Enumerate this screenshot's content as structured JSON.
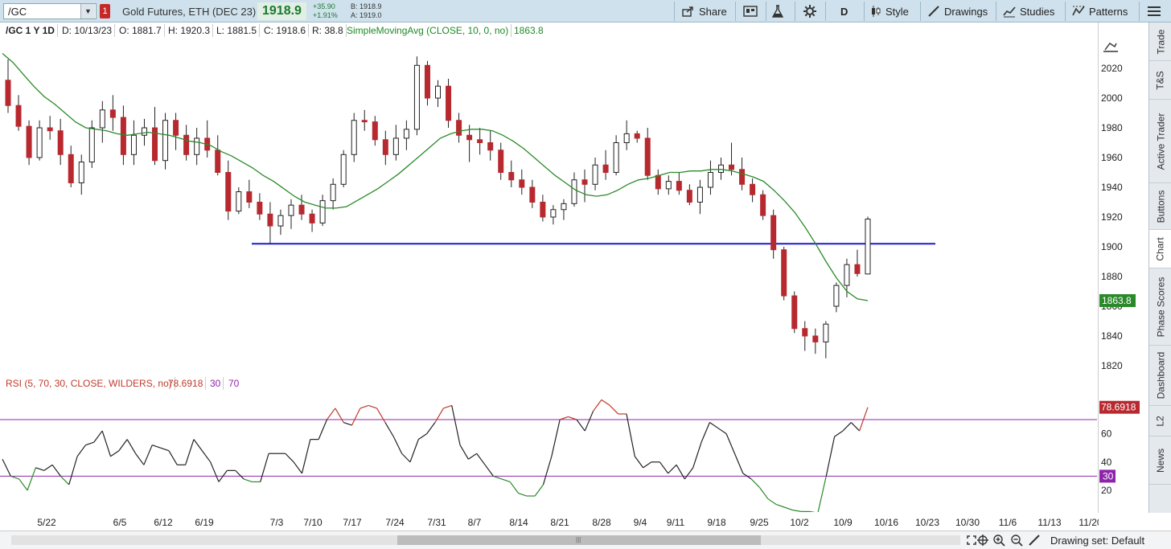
{
  "toolbar": {
    "symbol": "/GC",
    "alert_count": "1",
    "description": "Gold Futures, ETH (DEC 23)",
    "last_price": "1918.9",
    "net_change": "+35.90",
    "pct_change": "+1.91%",
    "bid": "B: 1918.9",
    "ask": "A: 1919.0",
    "share_label": "Share",
    "aggregation": "D",
    "style_label": "Style",
    "drawings_label": "Drawings",
    "studies_label": "Studies",
    "patterns_label": "Patterns"
  },
  "info_bar": {
    "symbol_period": "/GC 1 Y 1D",
    "date": "D: 10/13/23",
    "open": "O: 1881.7",
    "high": "H: 1920.3",
    "low": "L: 1881.5",
    "close": "C: 1918.6",
    "range": "R: 38.8",
    "study_label": "SimpleMovingAvg (CLOSE, 10, 0, no)",
    "study_value": "1863.8"
  },
  "rsi_header": {
    "label": "RSI (5, 70, 30, CLOSE, WILDERS, no)",
    "value": "78.6918",
    "oversold": "30",
    "overbought": "70"
  },
  "right_tabs": [
    "Trade",
    "T&S",
    "Active Trader",
    "Buttons",
    "Chart",
    "Phase Scores",
    "Dashboard",
    "L2",
    "News"
  ],
  "active_tab": "Chart",
  "bottom": {
    "drawing_set": "Drawing set: Default"
  },
  "colors": {
    "up_candle": "#ffffff",
    "down_candle": "#b8292f",
    "sma": "#2a8a2a",
    "support_line": "#1a1ad4",
    "rsi_normal": "#222222",
    "rsi_overbought": "#c0392b",
    "rsi_oversold": "#2a8a2a",
    "rsi_levels": "#8e24aa"
  },
  "chart_data": [
    {
      "type": "candlestick",
      "symbol": "/GC",
      "y_ticks": [
        1820,
        1840,
        1860,
        1880,
        1900,
        1920,
        1940,
        1960,
        1980,
        2000,
        2020
      ],
      "ylim": [
        1813,
        2035
      ],
      "x_tick_labels": [
        "5/22",
        "6/5",
        "6/12",
        "6/19",
        "7/3",
        "7/10",
        "7/17",
        "7/24",
        "7/31",
        "8/7",
        "8/14",
        "8/21",
        "8/28",
        "9/4",
        "9/11",
        "9/18",
        "9/25",
        "10/2",
        "10/9",
        "10/16",
        "10/23",
        "10/30",
        "11/6",
        "11/13",
        "11/20"
      ],
      "ohlc": [
        [
          2012,
          2026,
          1990,
          1995
        ],
        [
          1995,
          2002,
          1978,
          1981
        ],
        [
          1981,
          1985,
          1955,
          1960
        ],
        [
          1960,
          1985,
          1958,
          1980
        ],
        [
          1980,
          1988,
          1972,
          1978
        ],
        [
          1978,
          1986,
          1955,
          1962
        ],
        [
          1962,
          1968,
          1940,
          1943
        ],
        [
          1943,
          1962,
          1935,
          1957
        ],
        [
          1957,
          1985,
          1953,
          1980
        ],
        [
          1980,
          1998,
          1970,
          1992
        ],
        [
          1992,
          2002,
          1978,
          1987
        ],
        [
          1987,
          1995,
          1955,
          1962
        ],
        [
          1962,
          1985,
          1955,
          1975
        ],
        [
          1975,
          1986,
          1968,
          1980
        ],
        [
          1980,
          1994,
          1955,
          1958
        ],
        [
          1958,
          1990,
          1952,
          1985
        ],
        [
          1985,
          1990,
          1965,
          1975
        ],
        [
          1975,
          1982,
          1958,
          1962
        ],
        [
          1962,
          1980,
          1955,
          1973
        ],
        [
          1973,
          1985,
          1960,
          1965
        ],
        [
          1965,
          1975,
          1948,
          1950
        ],
        [
          1950,
          1958,
          1918,
          1924
        ],
        [
          1924,
          1940,
          1922,
          1937
        ],
        [
          1937,
          1945,
          1926,
          1930
        ],
        [
          1930,
          1936,
          1918,
          1922
        ],
        [
          1922,
          1930,
          1902,
          1914
        ],
        [
          1914,
          1925,
          1908,
          1921
        ],
        [
          1921,
          1932,
          1912,
          1928
        ],
        [
          1928,
          1935,
          1918,
          1922
        ],
        [
          1922,
          1925,
          1910,
          1916
        ],
        [
          1916,
          1935,
          1914,
          1931
        ],
        [
          1931,
          1946,
          1925,
          1942
        ],
        [
          1942,
          1965,
          1940,
          1962
        ],
        [
          1962,
          1990,
          1957,
          1985
        ],
        [
          1985,
          1992,
          1978,
          1984
        ],
        [
          1984,
          1988,
          1968,
          1972
        ],
        [
          1972,
          1978,
          1955,
          1962
        ],
        [
          1962,
          1982,
          1958,
          1973
        ],
        [
          1973,
          1985,
          1965,
          1979
        ],
        [
          1979,
          2028,
          1975,
          2022
        ],
        [
          2022,
          2025,
          1995,
          2000
        ],
        [
          2000,
          2012,
          1994,
          2008
        ],
        [
          2008,
          2013,
          1980,
          1985
        ],
        [
          1985,
          1990,
          1970,
          1975
        ],
        [
          1975,
          1982,
          1957,
          1972
        ],
        [
          1972,
          1980,
          1962,
          1970
        ],
        [
          1970,
          1978,
          1958,
          1965
        ],
        [
          1965,
          1970,
          1945,
          1950
        ],
        [
          1950,
          1958,
          1940,
          1945
        ],
        [
          1945,
          1952,
          1935,
          1940
        ],
        [
          1940,
          1945,
          1926,
          1930
        ],
        [
          1930,
          1935,
          1917,
          1920
        ],
        [
          1920,
          1928,
          1915,
          1925
        ],
        [
          1925,
          1932,
          1918,
          1929
        ],
        [
          1929,
          1950,
          1927,
          1945
        ],
        [
          1945,
          1952,
          1930,
          1942
        ],
        [
          1942,
          1960,
          1938,
          1955
        ],
        [
          1955,
          1965,
          1945,
          1950
        ],
        [
          1950,
          1975,
          1948,
          1970
        ],
        [
          1970,
          1985,
          1965,
          1976
        ],
        [
          1976,
          1978,
          1970,
          1973
        ],
        [
          1973,
          1980,
          1945,
          1948
        ],
        [
          1948,
          1952,
          1935,
          1939
        ],
        [
          1939,
          1948,
          1935,
          1944
        ],
        [
          1944,
          1950,
          1935,
          1938
        ],
        [
          1938,
          1942,
          1928,
          1930
        ],
        [
          1930,
          1945,
          1922,
          1940
        ],
        [
          1940,
          1958,
          1935,
          1950
        ],
        [
          1950,
          1960,
          1945,
          1955
        ],
        [
          1955,
          1970,
          1948,
          1952
        ],
        [
          1952,
          1960,
          1938,
          1942
        ],
        [
          1942,
          1946,
          1930,
          1935
        ],
        [
          1935,
          1938,
          1918,
          1921
        ],
        [
          1921,
          1925,
          1892,
          1898
        ],
        [
          1898,
          1900,
          1864,
          1867
        ],
        [
          1867,
          1870,
          1842,
          1845
        ],
        [
          1845,
          1850,
          1830,
          1840
        ],
        [
          1840,
          1845,
          1828,
          1836
        ],
        [
          1836,
          1850,
          1825,
          1848
        ],
        [
          1860,
          1876,
          1856,
          1874
        ],
        [
          1874,
          1892,
          1866,
          1888
        ],
        [
          1888,
          1898,
          1880,
          1882
        ],
        [
          1881.7,
          1920.3,
          1881.5,
          1918.6
        ]
      ],
      "sma_10": [
        2030,
        2024,
        2016,
        2008,
        2001,
        1996,
        1990,
        1984,
        1980,
        1979,
        1978,
        1976,
        1975,
        1976,
        1977,
        1976,
        1975,
        1973,
        1971,
        1970,
        1968,
        1964,
        1961,
        1957,
        1953,
        1948,
        1944,
        1939,
        1934,
        1930,
        1928,
        1926,
        1926,
        1927,
        1931,
        1935,
        1939,
        1944,
        1949,
        1955,
        1961,
        1967,
        1973,
        1976,
        1978,
        1979,
        1979,
        1978,
        1975,
        1971,
        1966,
        1960,
        1954,
        1948,
        1943,
        1938,
        1935,
        1934,
        1935,
        1938,
        1942,
        1945,
        1946,
        1948,
        1950,
        1950,
        1951,
        1951,
        1952,
        1952,
        1951,
        1949,
        1947,
        1944,
        1938,
        1931,
        1923,
        1913,
        1902,
        1890,
        1879,
        1870,
        1865,
        1863.8
      ],
      "support_level": 1902
    },
    {
      "type": "line",
      "title": "RSI (5, 70, 30, CLOSE, WILDERS, no)",
      "y_ticks": [
        20,
        40,
        60
      ],
      "ylim": [
        0,
        100
      ],
      "overbought": 70,
      "oversold": 30,
      "rsi": [
        42,
        30,
        28,
        20,
        36,
        34,
        38,
        30,
        24,
        44,
        52,
        54,
        62,
        44,
        48,
        56,
        46,
        38,
        52,
        50,
        48,
        38,
        38,
        56,
        48,
        40,
        26,
        34,
        34,
        28,
        26,
        26,
        46,
        46,
        46,
        40,
        32,
        56,
        56,
        70,
        78,
        68,
        66,
        78,
        80,
        78,
        68,
        58,
        46,
        40,
        56,
        60,
        68,
        78,
        80,
        52,
        42,
        46,
        38,
        30,
        28,
        26,
        18,
        16,
        16,
        24,
        44,
        70,
        72,
        70,
        62,
        76,
        84,
        80,
        74,
        74,
        44,
        36,
        40,
        40,
        32,
        38,
        28,
        36,
        54,
        68,
        64,
        60,
        46,
        32,
        28,
        22,
        14,
        10,
        8,
        6,
        5,
        5,
        4,
        30,
        58,
        62,
        68,
        62,
        78.69
      ]
    }
  ]
}
